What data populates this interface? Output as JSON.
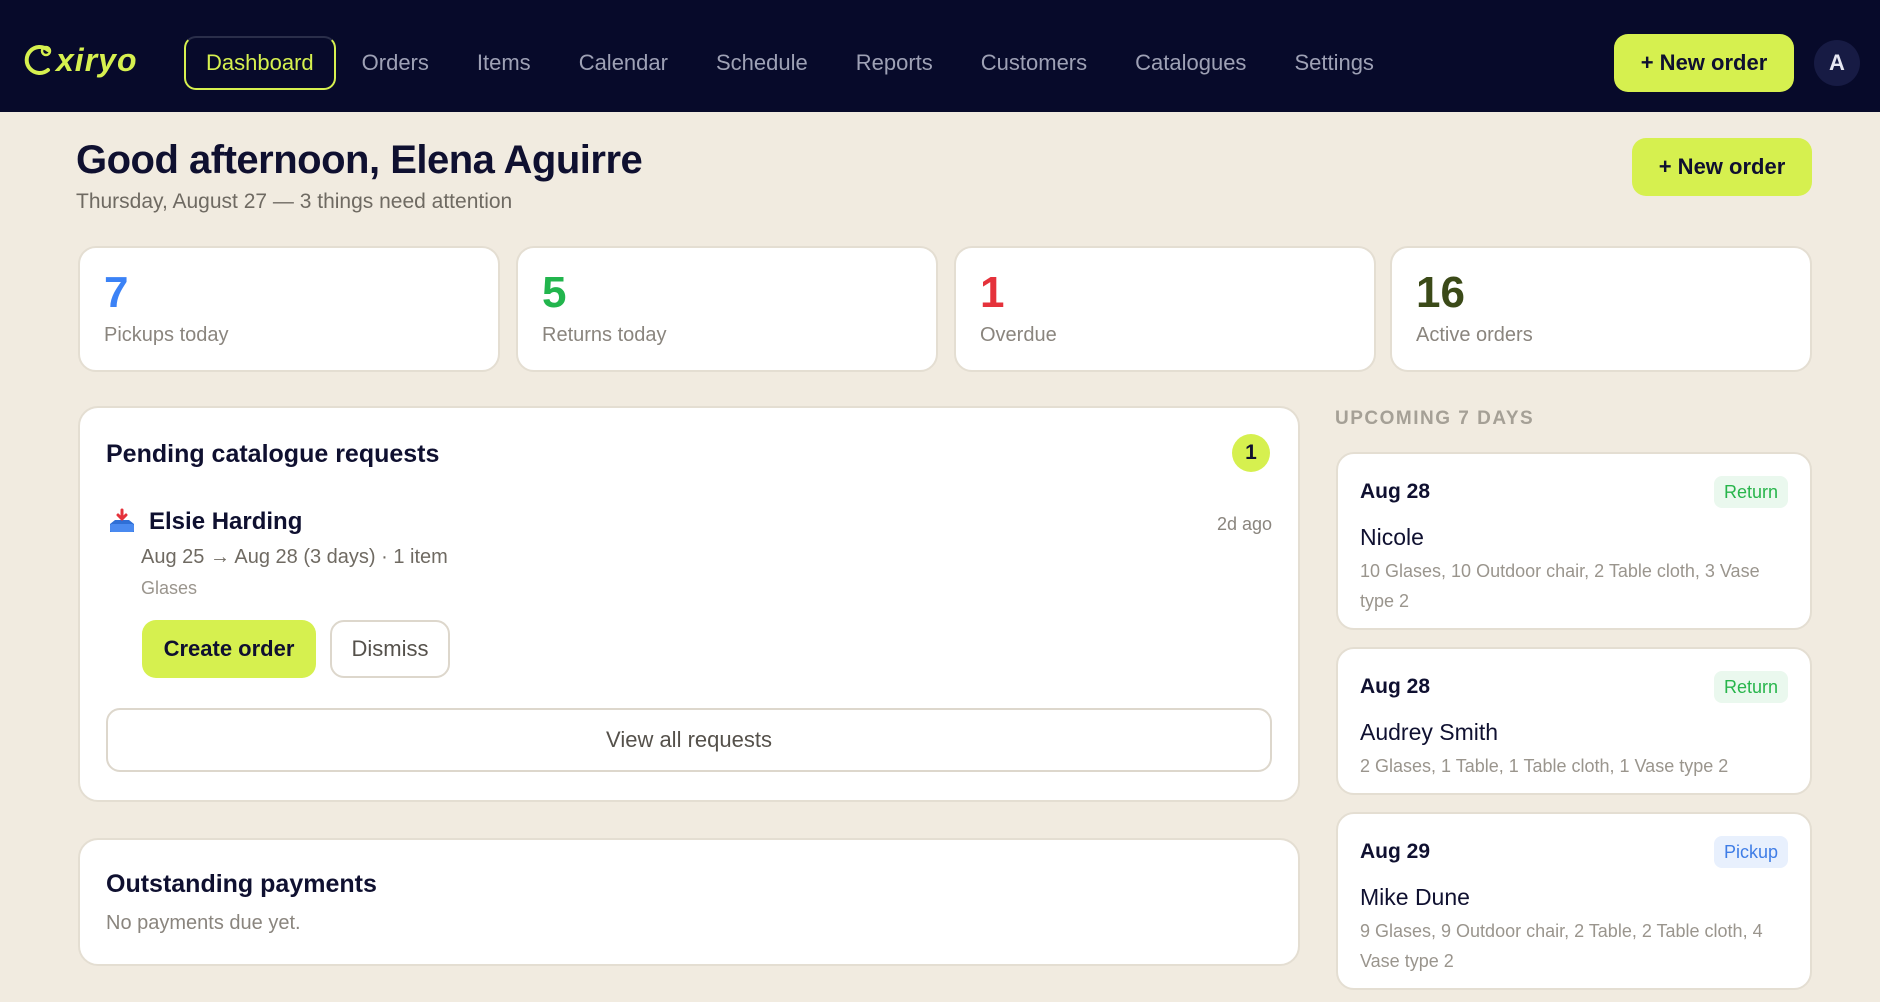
{
  "app": {
    "logo_text": "xiryo",
    "accent_color": "#d6f04f",
    "nav_bg_color": "#070a2a"
  },
  "nav": {
    "items": [
      "Dashboard",
      "Orders",
      "Items",
      "Calendar",
      "Schedule",
      "Reports",
      "Customers",
      "Catalogues",
      "Settings"
    ],
    "active": "Dashboard",
    "new_order_label": "+ New order",
    "avatar_initial": "A"
  },
  "header": {
    "greeting": "Good afternoon, Elena Aguirre",
    "subline": "Thursday, August 27 — 3 things need attention",
    "new_order_label": "+ New order"
  },
  "stats": [
    {
      "value": "7",
      "label": "Pickups today",
      "color": "#3b82f6"
    },
    {
      "value": "5",
      "label": "Returns today",
      "color": "#22b54d"
    },
    {
      "value": "1",
      "label": "Overdue",
      "color": "#e5323b"
    },
    {
      "value": "16",
      "label": "Active orders",
      "color": "#3b4a18"
    }
  ],
  "pending": {
    "title": "Pending catalogue requests",
    "count": "1",
    "request": {
      "icon": "inbox-tray-icon",
      "name": "Elsie Harding",
      "time_ago": "2d ago",
      "dates": "Aug 25 → Aug 28 (3 days) · 1 item",
      "items": "Glases",
      "create_label": "Create order",
      "dismiss_label": "Dismiss"
    },
    "view_all_label": "View all requests"
  },
  "payments": {
    "title": "Outstanding payments",
    "empty_text": "No payments due yet."
  },
  "upcoming": {
    "heading": "UPCOMING 7 DAYS",
    "events": [
      {
        "date": "Aug 28",
        "type": "Return",
        "name": "Nicole",
        "items": "10 Glases, 10 Outdoor chair, 2 Table cloth, 3 Vase type 2"
      },
      {
        "date": "Aug 28",
        "type": "Return",
        "name": "Audrey Smith",
        "items": "2 Glases, 1 Table, 1 Table cloth, 1 Vase type 2"
      },
      {
        "date": "Aug 29",
        "type": "Pickup",
        "name": "Mike Dune",
        "items": "9 Glases, 9 Outdoor chair, 2 Table, 2 Table cloth, 4 Vase type 2"
      }
    ]
  }
}
